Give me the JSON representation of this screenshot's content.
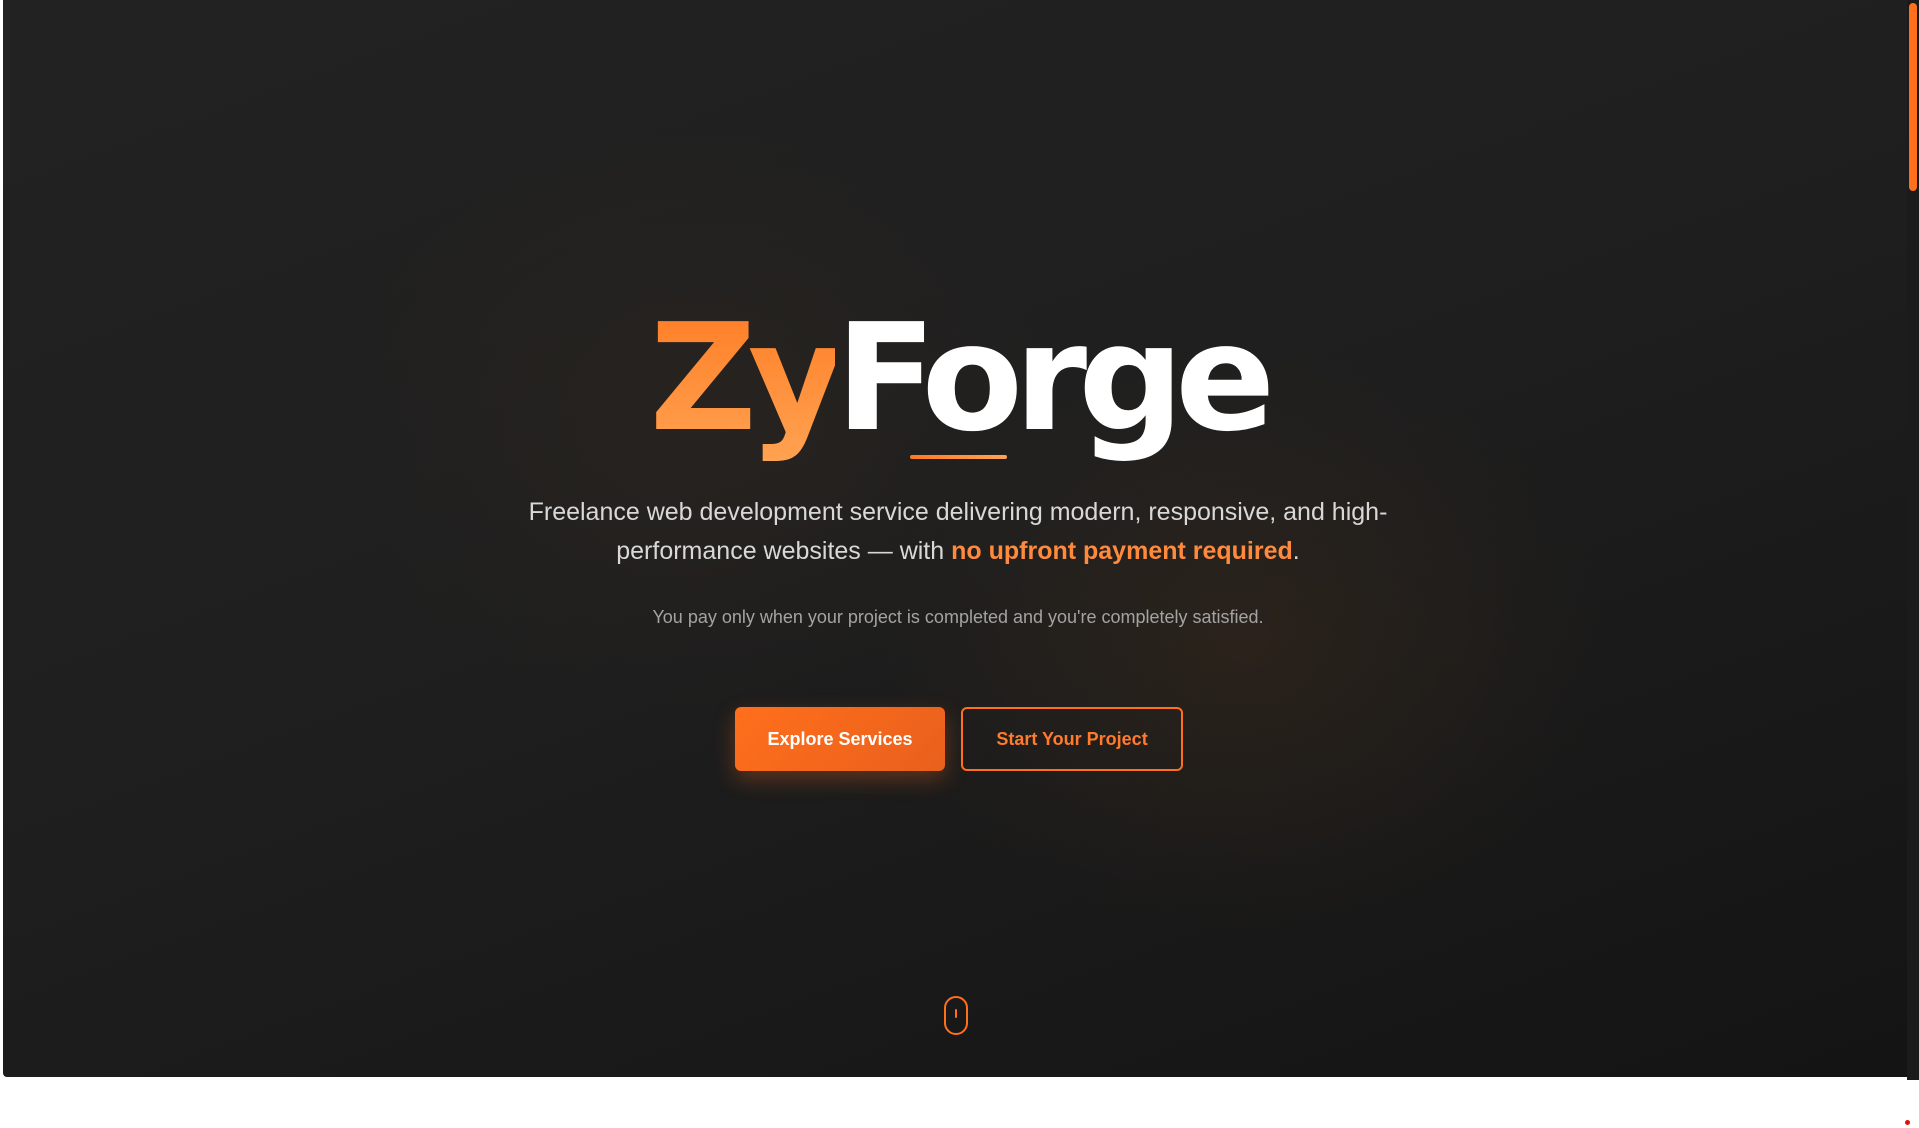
{
  "brand": {
    "name_accent": "Zy",
    "name_main": "Forge",
    "accent_color": "#ff6f1c"
  },
  "hero": {
    "lead_text": "Freelance web development service delivering modern, responsive, and high-performance websites — with ",
    "lead_highlight": "no upfront payment required",
    "lead_end": ".",
    "subtext": "You pay only when your project is completed and you're completely satisfied."
  },
  "buttons": {
    "primary_label": "Explore Services",
    "secondary_label": "Start Your Project"
  },
  "icons": {
    "scroll": "mouse-scroll-icon"
  }
}
